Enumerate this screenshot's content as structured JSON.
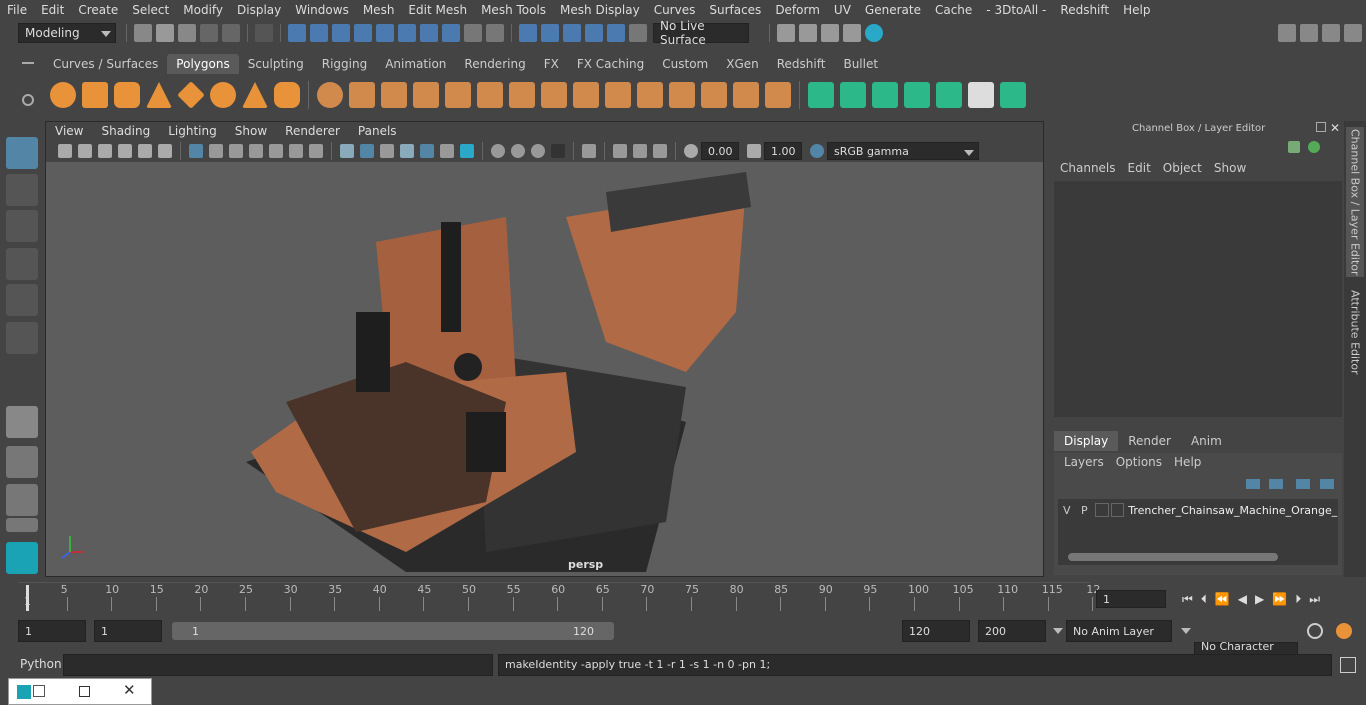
{
  "menubar": [
    "File",
    "Edit",
    "Create",
    "Select",
    "Modify",
    "Display",
    "Windows",
    "Mesh",
    "Edit Mesh",
    "Mesh Tools",
    "Mesh Display",
    "Curves",
    "Surfaces",
    "Deform",
    "UV",
    "Generate",
    "Cache",
    "- 3DtoAll -",
    "Redshift",
    "Help"
  ],
  "status": {
    "mode": "Modeling",
    "live_surface": "No Live Surface"
  },
  "shelf": {
    "tabs": [
      "Curves / Surfaces",
      "Polygons",
      "Sculpting",
      "Rigging",
      "Animation",
      "Rendering",
      "FX",
      "FX Caching",
      "Custom",
      "XGen",
      "Redshift",
      "Bullet"
    ],
    "active": "Polygons"
  },
  "viewport": {
    "menu": [
      "View",
      "Shading",
      "Lighting",
      "Show",
      "Renderer",
      "Panels"
    ],
    "exposure": "0.00",
    "gamma": "1.00",
    "colorspace": "sRGB gamma",
    "camera": "persp"
  },
  "channelbox": {
    "title": "Channel Box / Layer Editor",
    "menu": [
      "Channels",
      "Edit",
      "Object",
      "Show"
    ]
  },
  "layers": {
    "tabs": [
      "Display",
      "Render",
      "Anim"
    ],
    "active": "Display",
    "menu": [
      "Layers",
      "Options",
      "Help"
    ],
    "row": {
      "v": "V",
      "p": "P",
      "name": "Trencher_Chainsaw_Machine_Orange_N"
    }
  },
  "sidetabs": [
    "Channel Box / Layer Editor",
    "Attribute Editor"
  ],
  "timeline": {
    "labels": [
      "5",
      "10",
      "15",
      "20",
      "25",
      "30",
      "35",
      "40",
      "45",
      "50",
      "55",
      "60",
      "65",
      "70",
      "75",
      "80",
      "85",
      "90",
      "95",
      "100",
      "105",
      "110",
      "115",
      "12"
    ],
    "start_label": "1",
    "current": "1"
  },
  "range": {
    "start": "1",
    "playstart": "1",
    "slider_start": "1",
    "slider_end": "120",
    "end": "120",
    "maxend": "200",
    "anim_layer": "No Anim Layer",
    "char_set": "No Character Set"
  },
  "cmd": {
    "lang": "Python",
    "output": "makeIdentity -apply true -t 1 -r 1 -s 1 -n 0 -pn 1;"
  },
  "colors": {
    "accent": "#5285a6",
    "model": "#b06a45"
  }
}
